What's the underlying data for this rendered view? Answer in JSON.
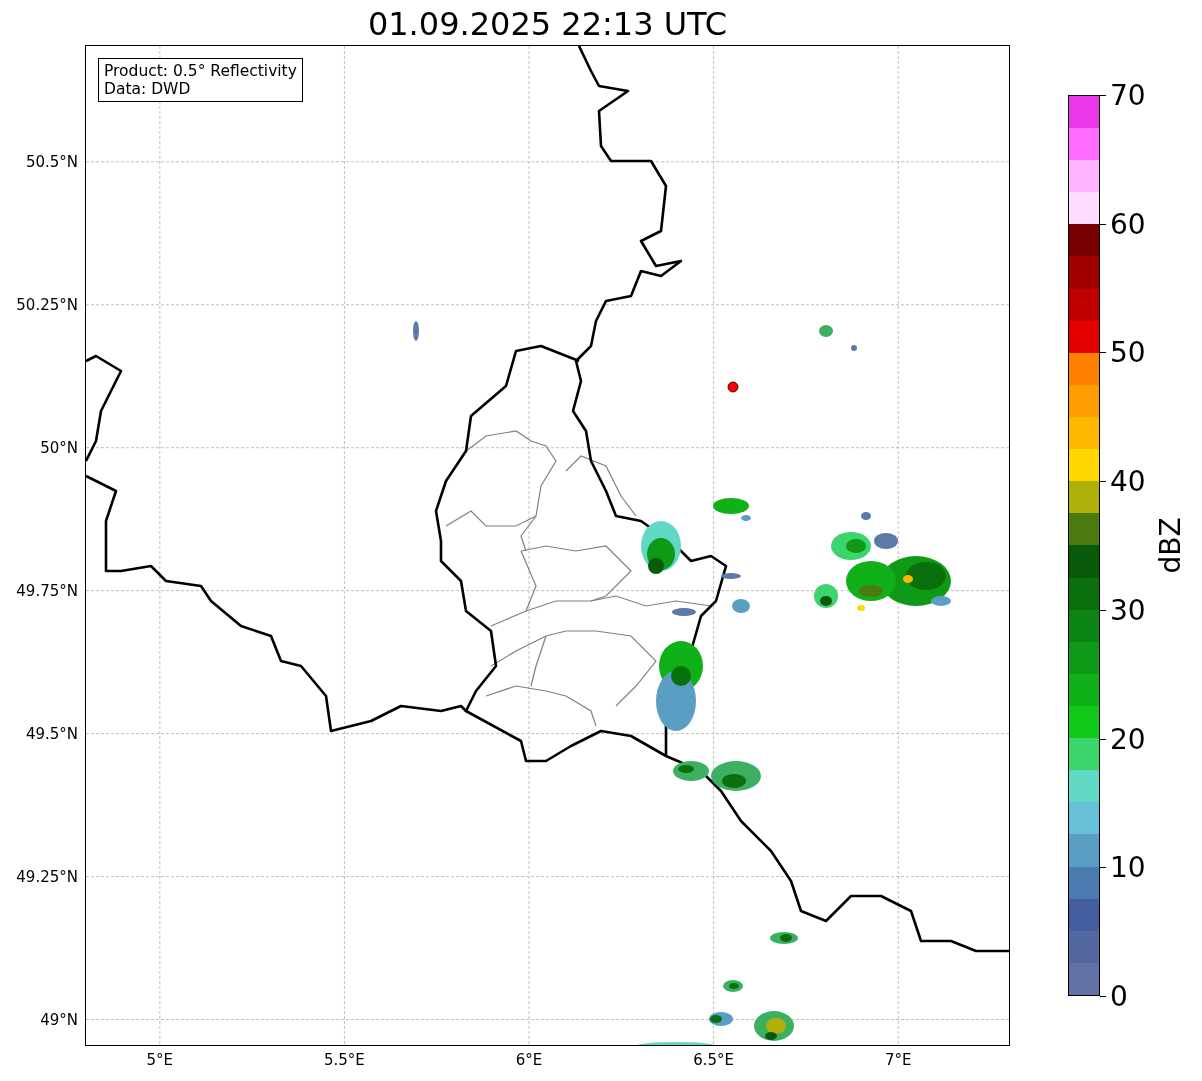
{
  "title": "01.09.2025 22:13 UTC",
  "info_box": {
    "lines": [
      "Product: 0.5° Reflectivity",
      "Data: DWD"
    ]
  },
  "map": {
    "x_ticks": [
      "5°E",
      "5.5°E",
      "6°E",
      "6.5°E",
      "7°E"
    ],
    "y_ticks": [
      "50.5°N",
      "50.25°N",
      "50°N",
      "49.75°N",
      "49.5°N",
      "49.25°N",
      "49°N"
    ]
  },
  "colorbar": {
    "label": "dBZ",
    "ticks": [
      "70",
      "60",
      "50",
      "40",
      "30",
      "20",
      "10",
      "0"
    ],
    "segments": [
      {
        "color": "#6272a6"
      },
      {
        "color": "#5468a0"
      },
      {
        "color": "#445ea0"
      },
      {
        "color": "#4a7ab0"
      },
      {
        "color": "#5a9ec4"
      },
      {
        "color": "#66c0d8"
      },
      {
        "color": "#60d8c4"
      },
      {
        "color": "#3cd46c"
      },
      {
        "color": "#10c818"
      },
      {
        "color": "#10b018"
      },
      {
        "color": "#0e9a16"
      },
      {
        "color": "#0c8414"
      },
      {
        "color": "#0a700e"
      },
      {
        "color": "#0a5a0c"
      },
      {
        "color": "#4a7a10"
      },
      {
        "color": "#b0b00a"
      },
      {
        "color": "#ffd800"
      },
      {
        "color": "#ffb800"
      },
      {
        "color": "#ff9c00"
      },
      {
        "color": "#ff8000"
      },
      {
        "color": "#e40000"
      },
      {
        "color": "#c00000"
      },
      {
        "color": "#a00000"
      },
      {
        "color": "#780000"
      },
      {
        "color": "#ffdcff"
      },
      {
        "color": "#ffb4ff"
      },
      {
        "color": "#ff6cff"
      },
      {
        "color": "#ea38ea"
      }
    ]
  }
}
